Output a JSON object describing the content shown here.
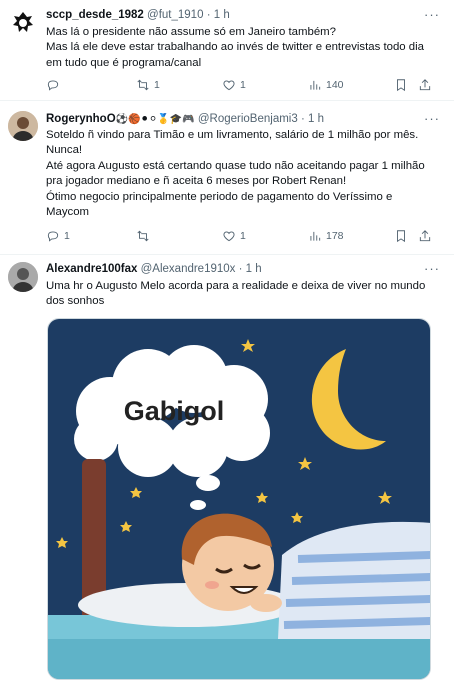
{
  "tweets": [
    {
      "name": "sccp_desde_1982",
      "handle": "@fut_1910",
      "dot": "·",
      "time": "1 h",
      "lines": [
        "Mas lá o presidente não assume só em Janeiro também?",
        "Mas lá ele deve estar trabalhando ao invés de twitter e entrevistas todo dia em tudo que é programa/canal"
      ],
      "replies": "",
      "reposts": "1",
      "likes": "1",
      "views": "140"
    },
    {
      "name": "RogerynhoO",
      "emojis": "⚽🏀⚫⚪🥇🎓🎮",
      "handle": "@RogerioBenjami3",
      "dot": "·",
      "time": "1 h",
      "lines": [
        "Soteldo ñ vindo para Timão e um livramento, salário de 1 milhão por mês. Nunca!",
        "Até agora Augusto está certando quase tudo não aceitando pagar 1 milhão pra jogador mediano e ñ aceita 6 meses por Robert Renan!",
        "Ótimo negocio principalmente periodo de pagamento do Veríssimo e Maycom"
      ],
      "replies": "1",
      "reposts": "",
      "likes": "1",
      "views": "178"
    },
    {
      "name": "Alexandre100fax",
      "handle": "@Alexandre1910x",
      "dot": "·",
      "time": "1 h",
      "lines": [
        "Uma hr o Augusto Melo acorda para a realidade e deixa de viver no mundo dos sonhos"
      ],
      "image_text": "Gabigol"
    }
  ],
  "more_label": "···",
  "icons": [
    "reply-icon",
    "repost-icon",
    "like-icon",
    "views-icon",
    "bookmark-icon",
    "share-icon"
  ],
  "colors": {
    "text": "#0f1419",
    "muted": "#536471",
    "divider": "#eff3f4",
    "night_sky": "#1d3c63",
    "moon": "#f4c542"
  }
}
